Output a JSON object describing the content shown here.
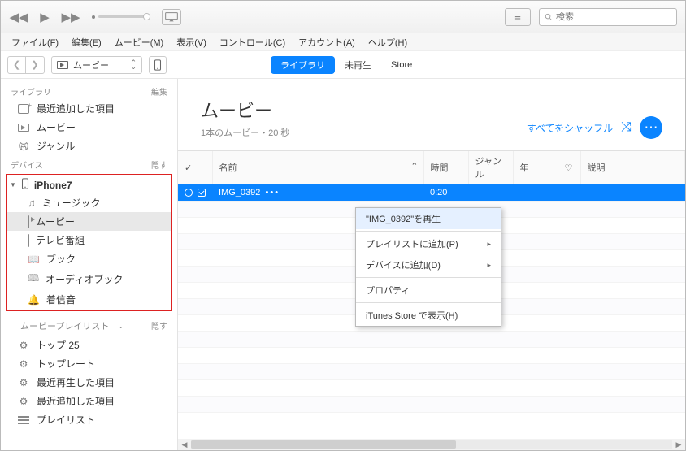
{
  "search": {
    "placeholder": "検索"
  },
  "menu": {
    "file": "ファイル(F)",
    "edit": "編集(E)",
    "movie": "ムービー(M)",
    "view": "表示(V)",
    "controls": "コントロール(C)",
    "account": "アカウント(A)",
    "help": "ヘルプ(H)"
  },
  "toolbar": {
    "media_label": "ムービー",
    "tab_library": "ライブラリ",
    "tab_unplayed": "未再生",
    "tab_store": "Store"
  },
  "sidebar": {
    "library_header": "ライブラリ",
    "edit_label": "編集",
    "devices_header": "デバイス",
    "hide_label": "隠す",
    "playlists_header": "ムービープレイリスト",
    "lib": {
      "recent": "最近追加した項目",
      "movies": "ムービー",
      "genres": "ジャンル"
    },
    "device_name": "iPhone7",
    "dev": {
      "music": "ミュージック",
      "movies": "ムービー",
      "tv": "テレビ番組",
      "books": "ブック",
      "audiobooks": "オーディオブック",
      "ringtones": "着信音"
    },
    "pl": {
      "top25": "トップ 25",
      "toprated": "トップレート",
      "recent_played": "最近再生した項目",
      "recent_added": "最近追加した項目",
      "playlist": "プレイリスト"
    }
  },
  "main": {
    "title": "ムービー",
    "subtitle": "1本のムービー・20 秒",
    "shuffle": "すべてをシャッフル"
  },
  "columns": {
    "check": "✓",
    "name": "名前",
    "time": "時間",
    "genre": "ジャンル",
    "year": "年",
    "heart": "♡",
    "description": "説明"
  },
  "rows": [
    {
      "name": "IMG_0392",
      "time": "0:20",
      "genre": "",
      "year": "",
      "description": ""
    }
  ],
  "context": {
    "play": "\"IMG_0392\"を再生",
    "add_playlist": "プレイリストに追加(P)",
    "add_device": "デバイスに追加(D)",
    "properties": "プロパティ",
    "show_store": "iTunes Store で表示(H)"
  },
  "chart_data": null
}
